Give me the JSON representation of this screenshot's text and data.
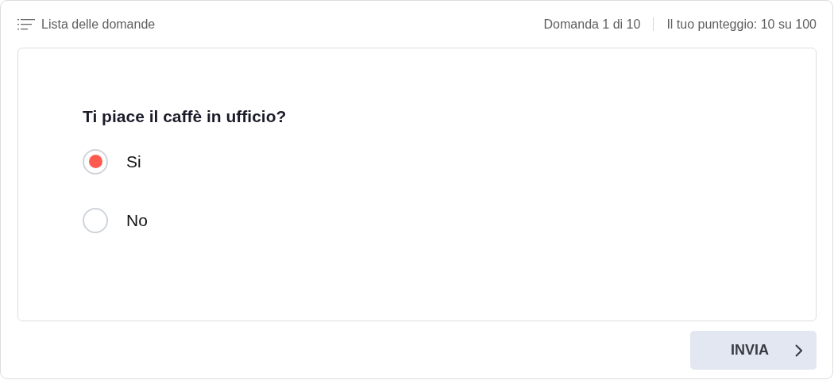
{
  "header": {
    "question_list_link": "Lista delle domande",
    "progress": "Domanda 1 di 10",
    "score": "Il tuo punteggio: 10 su 100"
  },
  "question": {
    "text": "Ti piace il caffè in ufficio?",
    "options": [
      {
        "label": "Si",
        "selected": true
      },
      {
        "label": "No",
        "selected": false
      }
    ]
  },
  "submit_button": {
    "label": "INVIA"
  }
}
